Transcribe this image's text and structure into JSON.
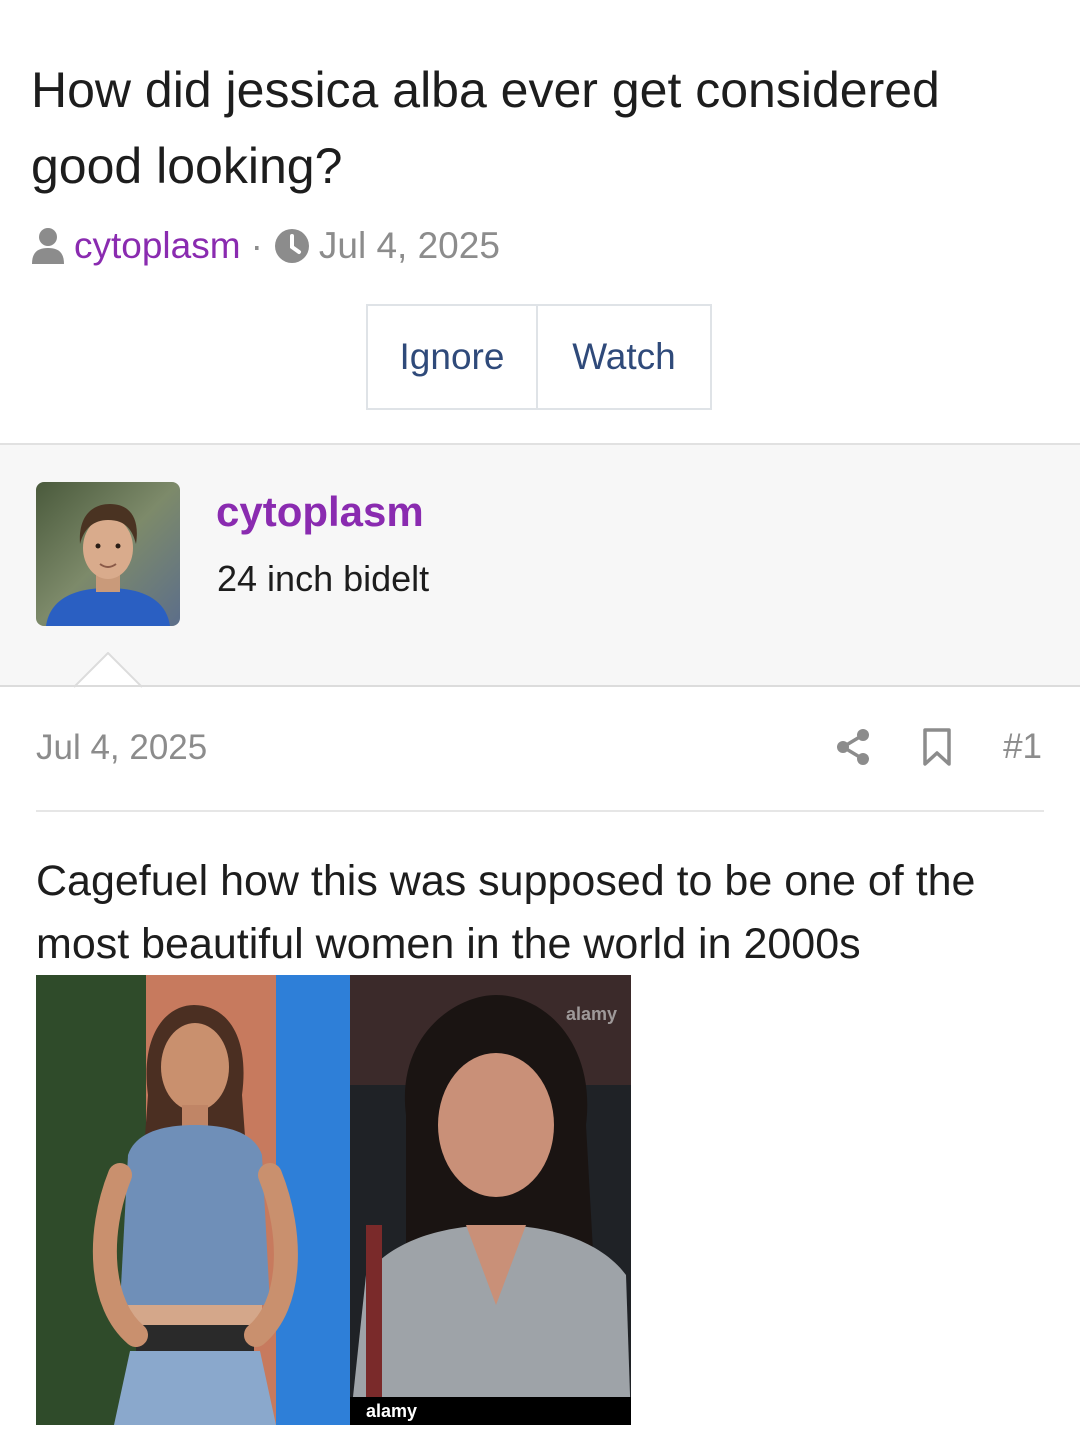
{
  "thread": {
    "title": "How did jessica alba ever get considered good looking?",
    "author": "cytoplasm",
    "separator": "·",
    "date": "Jul 4, 2025"
  },
  "actions": {
    "ignore_label": "Ignore",
    "watch_label": "Watch"
  },
  "post": {
    "username": "cytoplasm",
    "user_title": "24 inch bidelt",
    "date": "Jul 4, 2025",
    "number": "#1",
    "body": "Cagefuel how this was supposed to be one of the most beautiful women in the world in 2000s",
    "image_watermark": "alamy"
  },
  "icons": {
    "user": "user-icon",
    "clock": "clock-icon",
    "share": "share-icon",
    "bookmark": "bookmark-icon"
  },
  "colors": {
    "username": "#8a2bb0",
    "button_text": "#2f4a7a",
    "muted": "#8c8c8c",
    "user_block_bg": "#f7f7f7"
  }
}
